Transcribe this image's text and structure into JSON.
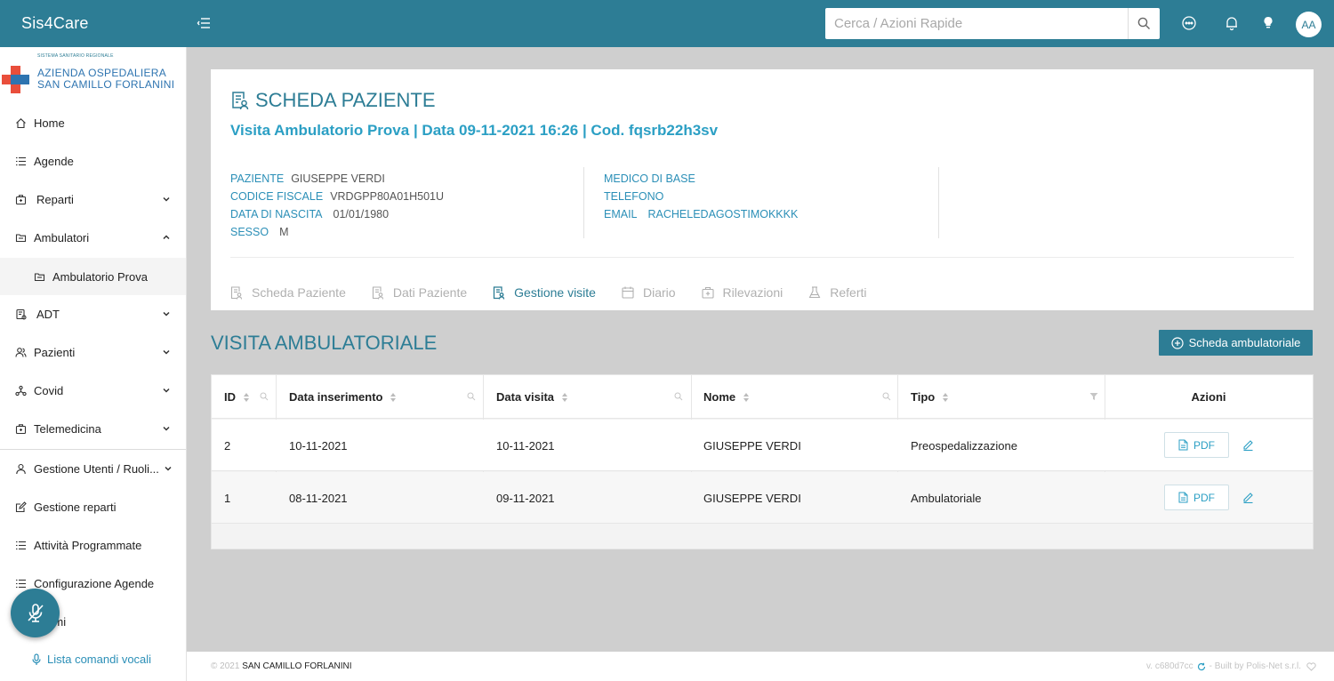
{
  "app": {
    "brand": "Sis4Care"
  },
  "search": {
    "placeholder": "Cerca / Azioni Rapide"
  },
  "user": {
    "initials": "AA"
  },
  "logo": {
    "small_text": "SISTEMA SANITARIO REGIONALE",
    "line1": "AZIENDA OSPEDALIERA",
    "line2": "SAN CAMILLO FORLANINI"
  },
  "sidebar": {
    "items": [
      {
        "label": "Home",
        "icon": "home-icon"
      },
      {
        "label": "Agende",
        "icon": "list-icon"
      },
      {
        "label": "Reparti",
        "icon": "briefcase-icon",
        "expandable": true
      },
      {
        "label": "Ambulatori",
        "icon": "folder-icon",
        "expandable": true,
        "expanded": true
      },
      {
        "label": "Ambulatorio Prova",
        "icon": "folder-icon",
        "sub": true
      },
      {
        "label": "ADT",
        "icon": "bed-icon",
        "expandable": true
      },
      {
        "label": "Pazienti",
        "icon": "users-icon",
        "expandable": true
      },
      {
        "label": "Covid",
        "icon": "virus-icon",
        "expandable": true
      },
      {
        "label": "Telemedicina",
        "icon": "medical-kit-icon",
        "expandable": true
      },
      {
        "label": "Gestione Utenti / Ruoli...",
        "icon": "user-icon",
        "expandable": true
      },
      {
        "label": "Gestione reparti",
        "icon": "edit-icon"
      },
      {
        "label": "Attività Programmate",
        "icon": "list-icon"
      },
      {
        "label": "Configurazione Agende",
        "icon": "list-icon"
      },
      {
        "label": "Esami",
        "icon": "list-icon"
      }
    ],
    "voice_commands_label": "Lista comandi vocali"
  },
  "patient": {
    "title": "SCHEDA PAZIENTE",
    "visit_line": "Visita Ambulatorio Prova | Data 09-11-2021 16:26 | Cod. fqsrb22h3sv",
    "left": [
      {
        "key": "PAZIENTE",
        "value": "GIUSEPPE VERDI"
      },
      {
        "key": "CODICE FISCALE",
        "value": "VRDGPP80A01H501U"
      },
      {
        "key": "DATA DI NASCITA",
        "value": "01/01/1980"
      },
      {
        "key": "SESSO",
        "value": "M"
      }
    ],
    "right": [
      {
        "key": "MEDICO DI BASE",
        "value": ""
      },
      {
        "key": "TELEFONO",
        "value": ""
      },
      {
        "key": "EMAIL",
        "value": "RACHELEDAGOSTIMOKKKK"
      }
    ]
  },
  "tabs": [
    {
      "label": "Scheda Paziente",
      "icon": "patient-card-icon",
      "active": false
    },
    {
      "label": "Dati Paziente",
      "icon": "patient-data-icon",
      "active": false
    },
    {
      "label": "Gestione visite",
      "icon": "visits-icon",
      "active": true
    },
    {
      "label": "Diario",
      "icon": "calendar-icon",
      "active": false
    },
    {
      "label": "Rilevazioni",
      "icon": "measurements-icon",
      "active": false
    },
    {
      "label": "Referti",
      "icon": "flask-icon",
      "active": false
    }
  ],
  "section": {
    "title": "VISITA AMBULATORIALE",
    "add_button": "Scheda ambulatoriale"
  },
  "table": {
    "columns": [
      "ID",
      "Data inserimento",
      "Data visita",
      "Nome",
      "Tipo",
      "Azioni"
    ],
    "rows": [
      {
        "id": "2",
        "data_inserimento": "10-11-2021",
        "data_visita": "10-11-2021",
        "nome": "GIUSEPPE VERDI",
        "tipo": "Preospedalizzazione",
        "pdf": "PDF"
      },
      {
        "id": "1",
        "data_inserimento": "08-11-2021",
        "data_visita": "09-11-2021",
        "nome": "GIUSEPPE VERDI",
        "tipo": "Ambulatoriale",
        "pdf": "PDF"
      }
    ]
  },
  "footer": {
    "copyright": "© 2021",
    "org": "SAN CAMILLO FORLANINI",
    "version": "v. c680d7cc",
    "built_by": "- Built by Polis-Net s.r.l."
  },
  "colors": {
    "primary": "#2d7d95",
    "accent": "#2b9fc4",
    "link": "#2b8fb7"
  }
}
